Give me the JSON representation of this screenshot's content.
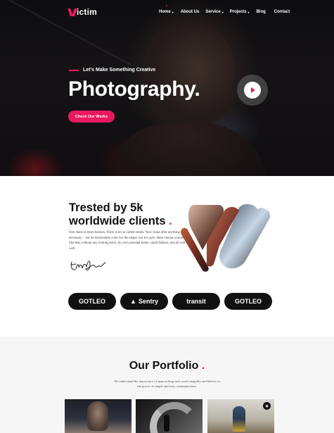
{
  "brand": {
    "name": "ictim",
    "accent": "#e8195e"
  },
  "nav": {
    "items": [
      {
        "label": "Home",
        "caret": "▾"
      },
      {
        "label": "About Us",
        "caret": ""
      },
      {
        "label": "Service",
        "caret": "▾"
      },
      {
        "label": "Projects",
        "caret": "▾"
      },
      {
        "label": "Blog",
        "caret": ""
      },
      {
        "label": "Contact",
        "caret": ""
      }
    ]
  },
  "hero": {
    "tagline": "Let's Make Something Creative",
    "title": "Photography.",
    "cta": "Check Our Works",
    "play_icon": "play-icon"
  },
  "about": {
    "title": "Trested by 5k worldwide clients",
    "dot": ".",
    "text": "Now there is more fashion. There is no so-called trends. Now chase after anything not necessary – nor be fashionable color nor the shape, nor for style. Here choose yourself like that, without any looking back, do your personal home, small fashion, and all will well"
  },
  "clients": [
    {
      "name": "GOTLEO",
      "symbol": ""
    },
    {
      "name": "Sentry",
      "symbol": "▲"
    },
    {
      "name": "transit",
      "symbol": ""
    },
    {
      "name": "GOTLEO",
      "symbol": ""
    }
  ],
  "portfolio": {
    "title": "Our Portfolio",
    "dot": ".",
    "text": "We understand the importance of approaching each work integrally and believe in the power of simple and easy communication.",
    "badge_icon": "camera-icon"
  }
}
